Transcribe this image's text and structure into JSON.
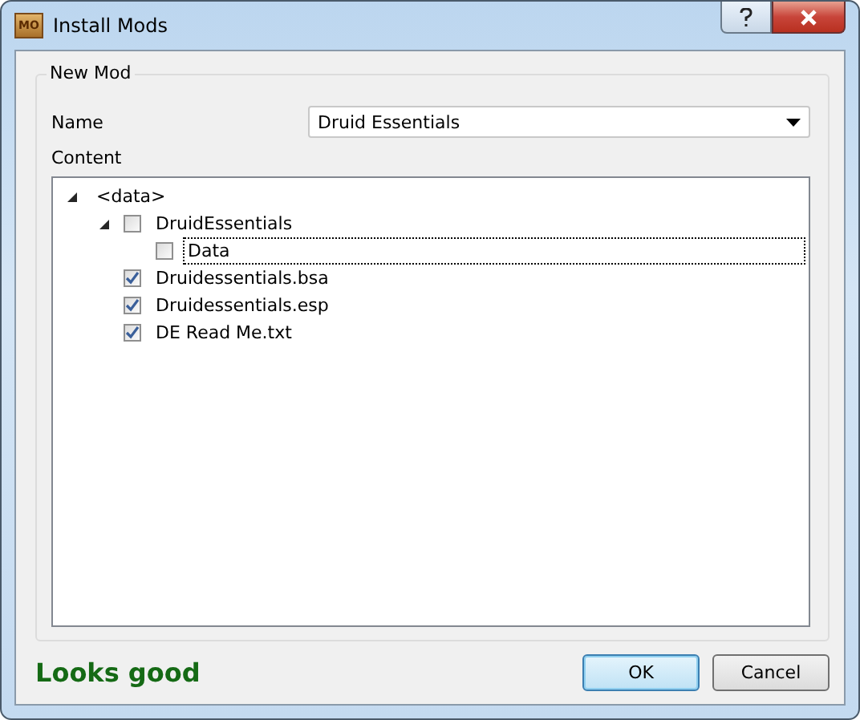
{
  "window": {
    "title": "Install Mods",
    "icon_text": "MO"
  },
  "group": {
    "title": "New Mod"
  },
  "name_field": {
    "label": "Name",
    "value": "Druid Essentials"
  },
  "content": {
    "label": "Content",
    "tree": {
      "label": "<data>",
      "expanded": true,
      "children": [
        {
          "label": "DruidEssentials",
          "checked": false,
          "focused": false,
          "expanded": true,
          "children": [
            {
              "label": "Data",
              "checked": false,
              "focused": true
            }
          ]
        },
        {
          "label": "Druidessentials.bsa",
          "checked": true,
          "focused": false
        },
        {
          "label": "Druidessentials.esp",
          "checked": true,
          "focused": false
        },
        {
          "label": "DE Read Me.txt",
          "checked": true,
          "focused": false
        }
      ]
    }
  },
  "status": {
    "text": "Looks good"
  },
  "buttons": [
    {
      "label": "OK",
      "default": true
    },
    {
      "label": "Cancel",
      "default": false
    }
  ]
}
